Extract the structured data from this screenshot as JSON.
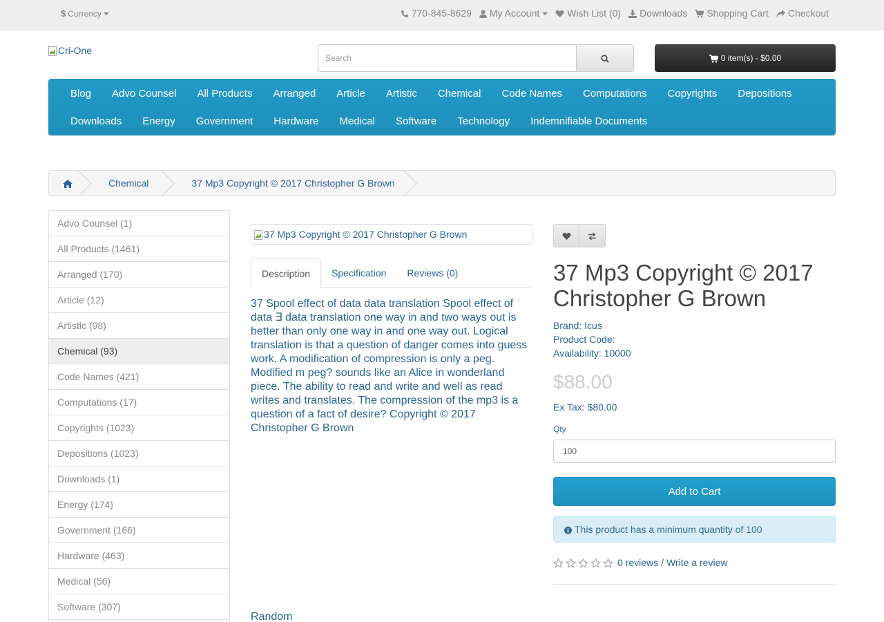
{
  "top_bar": {
    "currency": "Currency",
    "phone": "770-845-8629",
    "my_account": "My Account",
    "wish_list": "Wish List (0)",
    "downloads": "Downloads",
    "shopping_cart": "Shopping Cart",
    "checkout": "Checkout"
  },
  "header": {
    "logo_alt": "Cri-One",
    "search_placeholder": "Search",
    "cart_summary": "0 item(s) - $0.00"
  },
  "menu": {
    "row1": [
      "Blog",
      "Advo Counsel",
      "All Products",
      "Arranged",
      "Article",
      "Artistic",
      "Chemical",
      "Code Names",
      "Computations",
      "Copyrights",
      "Depositions"
    ],
    "row2": [
      "Downloads",
      "Energy",
      "Government",
      "Hardware",
      "Medical",
      "Software",
      "Technology",
      "Indemnifiable Documents"
    ]
  },
  "breadcrumb": {
    "category": "Chemical",
    "product": "37 Mp3 Copyright © 2017 Christopher G Brown"
  },
  "sidebar": {
    "items": [
      "Advo Counsel (1)",
      "All Products (1461)",
      "Arranged (170)",
      "Article (12)",
      "Artistic (98)",
      "Chemical (93)",
      "Code Names (421)",
      "Computations (17)",
      "Copyrights (1023)",
      "Depositions (1023)",
      "Downloads (1)",
      "Energy (174)",
      "Government (166)",
      "Hardware (463)",
      "Medical (56)",
      "Software (307)"
    ],
    "active_index": 5
  },
  "product": {
    "image_alt": "37 Mp3 Copyright © 2017 Christopher G Brown",
    "tabs": [
      "Description",
      "Specification",
      "Reviews (0)"
    ],
    "description": "37 Spool effect of data data translation Spool effect of data ∃ data translation one way in and two ways out is better than only one way in and one way out. Logical translation is that a question of danger comes into guess work. A modification of compression is only a peg. Modified m peg? sounds like an Alice in wonderland piece. The ability to read and write and well as read writes and translates. The compression of the mp3 is a question of a fact of desire? Copyright © 2017 Christopher G Brown",
    "random_heading": "Random",
    "title": "37 Mp3 Copyright © 2017 Christopher G Brown",
    "brand_label": "Brand:",
    "brand_value": "Icus",
    "code_label": "Product Code:",
    "availability_label": "Availability:",
    "availability_value": "10000",
    "price": "$88.00",
    "ex_tax": "Ex Tax: $80.00",
    "qty_label": "Qty",
    "qty_value": "100",
    "add_to_cart": "Add to Cart",
    "min_quantity_alert": "This product has a minimum quantity of 100",
    "reviews_link": "0 reviews",
    "review_separator": "/",
    "write_review_link": "Write a review",
    "rating": 0,
    "rating_max": 5
  },
  "colors": {
    "menu_blue": "#229ac8",
    "link_blue": "#2a6496",
    "cart_dark": "#333333",
    "alert_bg": "#d9edf7"
  }
}
